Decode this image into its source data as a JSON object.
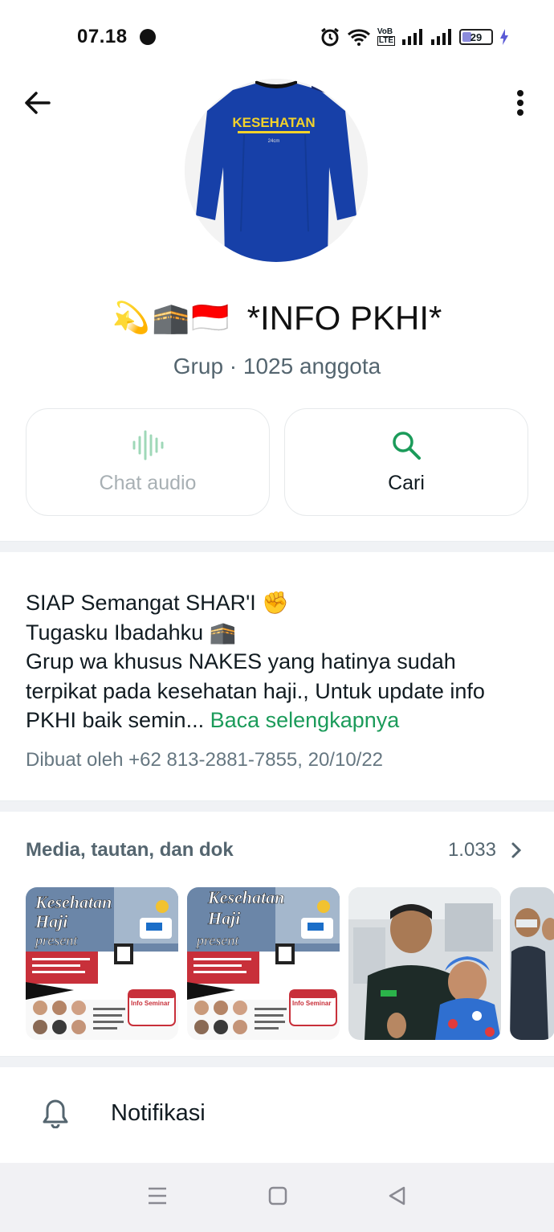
{
  "status_bar": {
    "time": "07.18",
    "network_badge_top": "VoB",
    "network_badge_bottom": "LTE",
    "battery": "29"
  },
  "profile": {
    "title": "*INFO PKHI*",
    "emojis": [
      "💫",
      "🕋",
      "🇮🇩"
    ],
    "subtitle": "Grup · 1025 anggota",
    "avatar_text": "KESEHATAN",
    "avatar_subtext": "24cm"
  },
  "actions": {
    "audio_label": "Chat audio",
    "search_label": "Cari"
  },
  "description": {
    "line1": "SIAP Semangat SHAR'I ✊",
    "line2": "Tugasku Ibadahku 🕋",
    "body": "Grup wa khusus NAKES yang hatinya sudah terpikat pada kesehatan haji.,  Untuk update info PKHI baik semin...",
    "read_more": "Baca selengkapnya",
    "created": "Dibuat oleh +62 813-2881-7855, 20/10/22"
  },
  "media": {
    "title": "Media, tautan, dan dok",
    "count": "1.033",
    "poster_title_1": "Kesehatan",
    "poster_title_2": "Haji",
    "poster_title_3": "present",
    "poster_badge": "Info Seminar"
  },
  "notifications": {
    "label": "Notifikasi"
  },
  "colors": {
    "accent": "#1b9b5a",
    "jersey": "#1740a8",
    "jersey_text": "#f2d22b"
  }
}
